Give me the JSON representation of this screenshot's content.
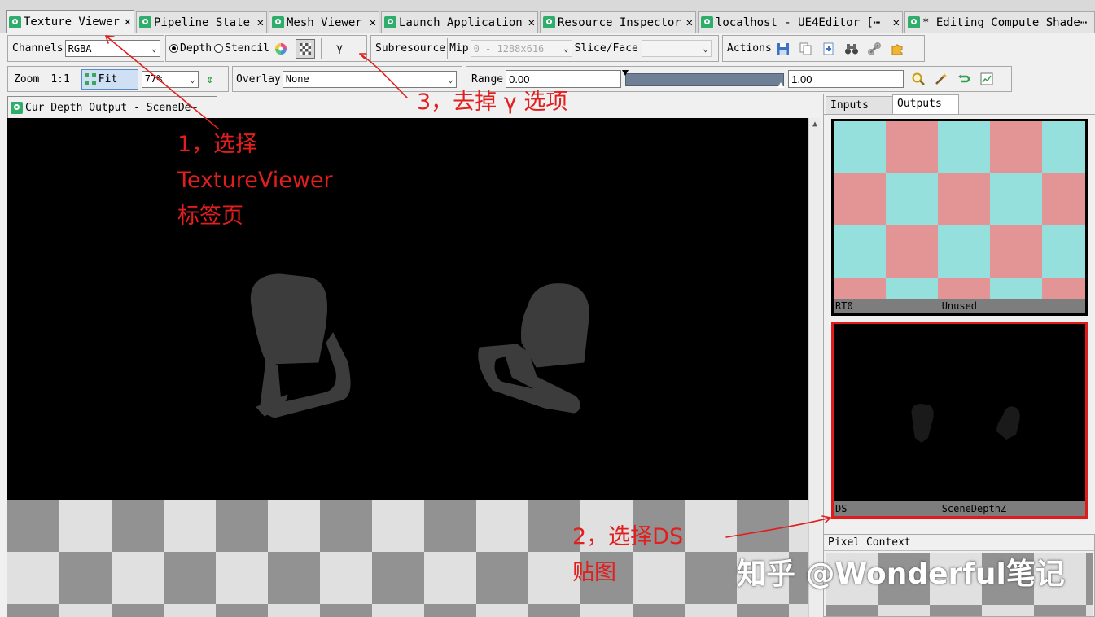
{
  "tabs": [
    {
      "label": "Texture Viewer",
      "close": "✕"
    },
    {
      "label": "Pipeline State",
      "close": "✕"
    },
    {
      "label": "Mesh Viewer",
      "close": "✕"
    },
    {
      "label": "Launch Application",
      "close": "✕"
    },
    {
      "label": "Resource Inspector",
      "close": "✕"
    },
    {
      "label": "localhost - UE4Editor [⋯",
      "close": "✕"
    },
    {
      "label": "* Editing Compute Shade⋯",
      "close": ""
    }
  ],
  "toolbar1": {
    "channels_label": "Channels",
    "channels_value": "RGBA",
    "depth_label": "Depth",
    "stencil_label": "Stencil",
    "gamma_label": "γ",
    "subresource_label": "Subresource",
    "mip_label": "Mip",
    "mip_value": "0 - 1288x616",
    "slice_label": "Slice/Face",
    "slice_value": "",
    "actions_label": "Actions"
  },
  "toolbar2": {
    "zoom_label": "Zoom",
    "zoom_ratio": "1:1",
    "fit_label": "Fit",
    "zoom_value": "77%",
    "overlay_label": "Overlay",
    "overlay_value": "None",
    "range_label": "Range",
    "range_min": "0.00",
    "range_max": "1.00"
  },
  "view": {
    "tab_label": "Cur Depth Output - SceneDe⋯"
  },
  "right_panel": {
    "tabs": [
      "Inputs",
      "Outputs"
    ],
    "active_tab": "Outputs",
    "thumbnails": [
      {
        "slot": "RT0",
        "name": "Unused",
        "selected": false
      },
      {
        "slot": "DS",
        "name": "SceneDepthZ",
        "selected": true
      }
    ]
  },
  "pixel_context": {
    "title": "Pixel Context"
  },
  "annotations": {
    "note1_line1": "1，选择",
    "note1_line2": "TextureViewer",
    "note1_line3": "标签页",
    "note2_line1": "2，选择DS",
    "note2_line2": "贴图",
    "note3": "3，去掉 γ 选项",
    "color": "#e21e1e"
  },
  "watermark": "知乎 @Wonderful笔记"
}
